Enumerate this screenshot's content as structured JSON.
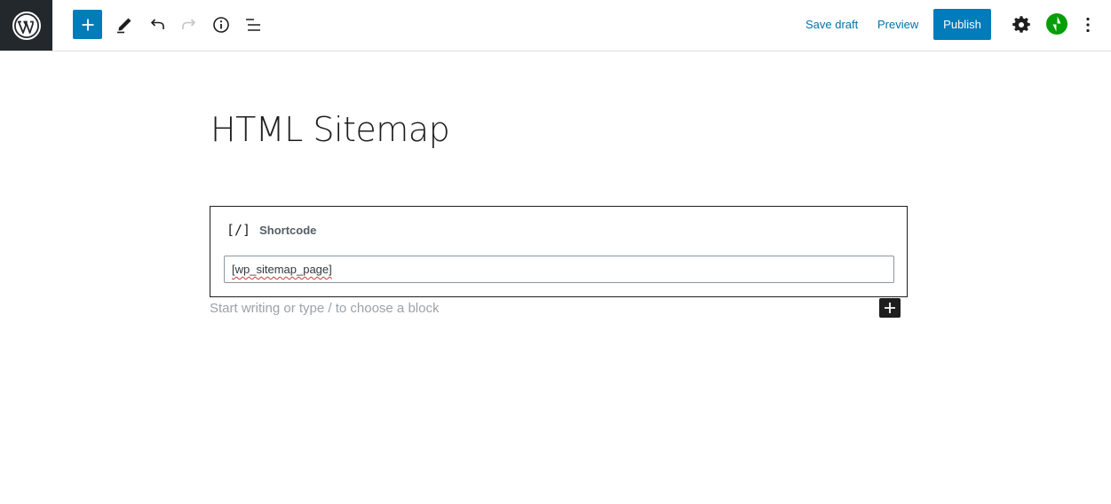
{
  "toolbar": {
    "logo_icon": "wordpress-icon",
    "inserter_icon": "plus-icon",
    "tools_icon": "pencil-icon",
    "undo_icon": "undo-icon",
    "redo_icon": "redo-icon",
    "info_icon": "info-icon",
    "outline_icon": "list-view-icon",
    "save_draft_label": "Save draft",
    "preview_label": "Preview",
    "publish_label": "Publish",
    "settings_icon": "gear-icon",
    "jetpack_icon": "jetpack-icon",
    "more_icon": "more-vertical-icon",
    "accent_color": "#007cba"
  },
  "editor": {
    "title": "HTML Sitemap",
    "shortcode_block": {
      "icon_text": "[/]",
      "label": "Shortcode",
      "value": "[wp_sitemap_page]"
    },
    "appender": {
      "placeholder": "Start writing or type / to choose a block",
      "add_icon": "plus-icon"
    }
  }
}
